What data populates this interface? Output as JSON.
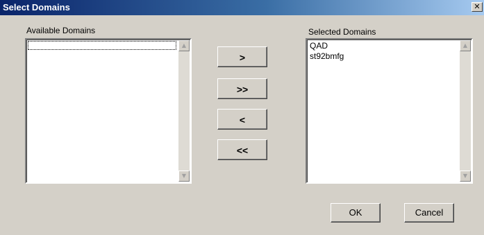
{
  "window": {
    "title": "Select Domains",
    "close_glyph": "✕",
    "close_icon": "close-icon"
  },
  "available": {
    "label": "Available Domains",
    "items": []
  },
  "selected": {
    "label": "Selected Domains",
    "items": [
      "QAD",
      "st92bmfg"
    ]
  },
  "buttons": {
    "add": ">",
    "add_all": ">>",
    "remove": "<",
    "remove_all": "<<",
    "ok": "OK",
    "cancel": "Cancel"
  },
  "scroll": {
    "up_glyph": "▲",
    "down_glyph": "▼"
  }
}
